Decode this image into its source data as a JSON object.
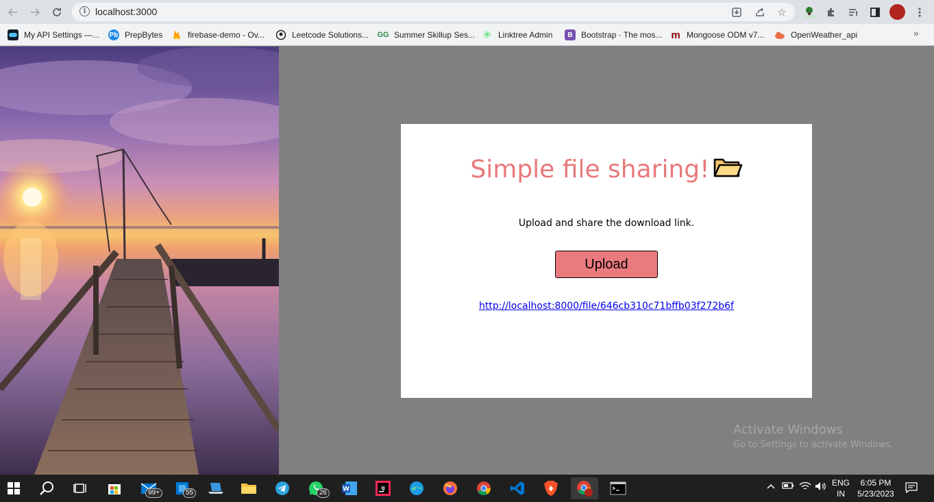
{
  "browser": {
    "url": "localhost:3000",
    "bookmarks": [
      {
        "label": "My API Settings —...",
        "icon": "api-settings-icon"
      },
      {
        "label": "PrepBytes",
        "icon": "prepbytes-icon"
      },
      {
        "label": "firebase-demo - Ov...",
        "icon": "firebase-icon"
      },
      {
        "label": "Leetcode Solutions...",
        "icon": "github-icon"
      },
      {
        "label": "Summer Skillup Ses...",
        "icon": "geeksforgeeks-icon"
      },
      {
        "label": "Linktree Admin",
        "icon": "linktree-icon"
      },
      {
        "label": "Bootstrap · The mos...",
        "icon": "bootstrap-icon"
      },
      {
        "label": "Mongoose ODM v7...",
        "icon": "mongoose-icon"
      },
      {
        "label": "OpenWeather_api",
        "icon": "openweather-icon"
      }
    ],
    "bookmarks_more": "»"
  },
  "app": {
    "title": "Simple file sharing!",
    "subtitle": "Upload and share the download link.",
    "upload_label": "Upload",
    "link": "http://localhost:8000/file/646cb310c71bffb03f272b6f"
  },
  "watermark": {
    "line1": "Activate Windows",
    "line2": "Go to Settings to activate Windows."
  },
  "taskbar": {
    "mail_badge": "99+",
    "store_badge": "55",
    "whatsapp_badge": "26",
    "lang_line1": "ENG",
    "lang_line2": "IN",
    "time": "6:05 PM",
    "date": "5/23/2023"
  },
  "colors": {
    "title": "#e8797b",
    "button": "#ea7a7e",
    "link": "#0000ee",
    "page_bg": "#808080"
  }
}
